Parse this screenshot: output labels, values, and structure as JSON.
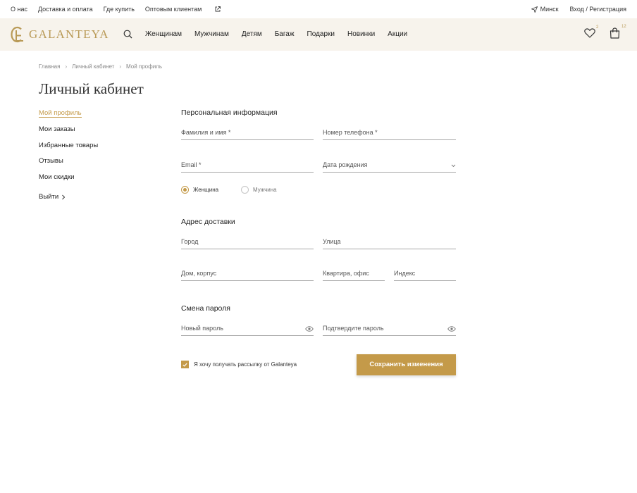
{
  "topbar": {
    "links": [
      "О нас",
      "Доставка и оплата",
      "Где купить",
      "Оптовым клиентам"
    ],
    "city": "Минск",
    "auth": "Вход / Регистрация"
  },
  "header": {
    "logo_text": "GALANTEYA",
    "nav": [
      "Женщинам",
      "Мужчинам",
      "Детям",
      "Багаж",
      "Подарки",
      "Новинки",
      "Акции"
    ],
    "wishlist_count": "2",
    "cart_count": "12"
  },
  "breadcrumb": [
    "Главная",
    "Личный кабинет",
    "Мой профиль"
  ],
  "page_title": "Личный кабинет",
  "sidebar": {
    "items": [
      "Мой профиль",
      "Мои заказы",
      "Избранные товары",
      "Отзывы",
      "Мои скидки"
    ],
    "logout": "Выйти",
    "active_index": 0
  },
  "form": {
    "personal_title": "Персональная информация",
    "name_label": "Фамилия и имя *",
    "phone_label": "Номер телефона *",
    "email_label": "Email *",
    "birth_label": "Дата рождения",
    "gender_female": "Женщина",
    "gender_male": "Мужчина",
    "gender_selected": "Женщина",
    "address_title": "Адрес доставки",
    "city_label": "Город",
    "street_label": "Улица",
    "house_label": "Дом, корпус",
    "flat_label": "Квартира, офис",
    "index_label": "Индекс",
    "password_title": "Смена пароля",
    "new_password_label": "Новый пароль",
    "confirm_password_label": "Подтвердите пароль",
    "newsletter_label": "Я хочу получать рассылку от Galanteya",
    "newsletter_checked": true,
    "save_label": "Сохранить изменения"
  },
  "colors": {
    "accent": "#c49a49",
    "logo": "#b99a57",
    "header_bg": "#f7f3ec"
  }
}
